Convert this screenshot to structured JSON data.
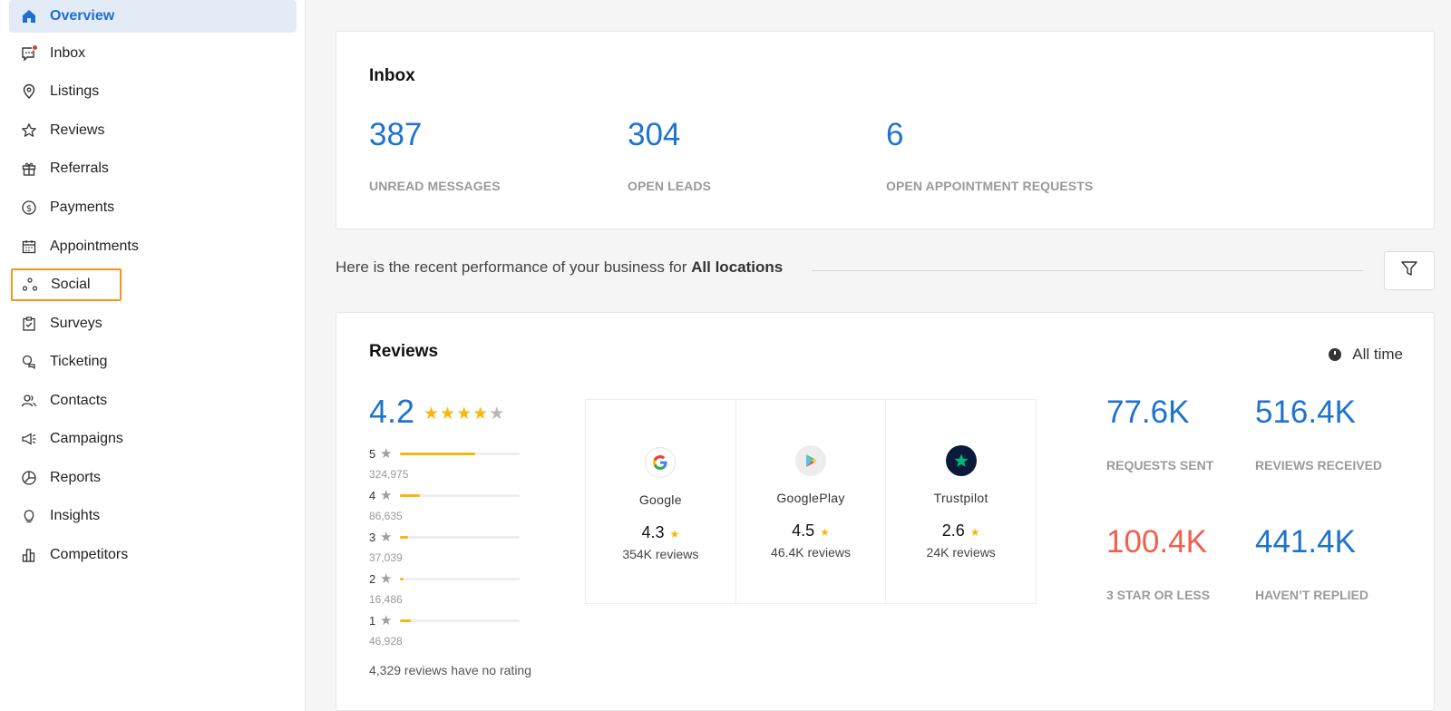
{
  "sidebar": {
    "items": [
      {
        "key": "overview",
        "label": "Overview",
        "icon": "home-icon"
      },
      {
        "key": "inbox",
        "label": "Inbox",
        "icon": "inbox-icon"
      },
      {
        "key": "listings",
        "label": "Listings",
        "icon": "location-pin-icon"
      },
      {
        "key": "reviews",
        "label": "Reviews",
        "icon": "star-icon"
      },
      {
        "key": "referrals",
        "label": "Referrals",
        "icon": "gift-icon"
      },
      {
        "key": "payments",
        "label": "Payments",
        "icon": "dollar-icon"
      },
      {
        "key": "appointments",
        "label": "Appointments",
        "icon": "calendar-icon"
      },
      {
        "key": "social",
        "label": "Social",
        "icon": "social-nodes-icon"
      },
      {
        "key": "surveys",
        "label": "Surveys",
        "icon": "survey-check-icon"
      },
      {
        "key": "ticketing",
        "label": "Ticketing",
        "icon": "chat-bubbles-icon"
      },
      {
        "key": "contacts",
        "label": "Contacts",
        "icon": "contacts-icon"
      },
      {
        "key": "campaigns",
        "label": "Campaigns",
        "icon": "megaphone-icon"
      },
      {
        "key": "reports",
        "label": "Reports",
        "icon": "pie-chart-icon"
      },
      {
        "key": "insights",
        "label": "Insights",
        "icon": "lightbulb-icon"
      },
      {
        "key": "competitors",
        "label": "Competitors",
        "icon": "bar-chart-icon"
      }
    ],
    "active": "Overview",
    "highlighted": "Social"
  },
  "inbox": {
    "title": "Inbox",
    "stats": [
      {
        "value": "387",
        "caption": "UNREAD MESSAGES"
      },
      {
        "value": "304",
        "caption": "OPEN LEADS"
      },
      {
        "value": "6",
        "caption": "OPEN APPOINTMENT REQUESTS"
      }
    ]
  },
  "performance": {
    "text": "Here is the recent performance of your business for",
    "location": "All locations",
    "filter_icon": "filter-icon"
  },
  "reviews": {
    "title": "Reviews",
    "period": "All time",
    "average": "4.2",
    "stars_filled": 4,
    "distribution": [
      {
        "stars": "5",
        "count": "324,975",
        "fraction": 0.63
      },
      {
        "stars": "4",
        "count": "86,635",
        "fraction": 0.17
      },
      {
        "stars": "3",
        "count": "37,039",
        "fraction": 0.07
      },
      {
        "stars": "2",
        "count": "16,486",
        "fraction": 0.03
      },
      {
        "stars": "1",
        "count": "46,928",
        "fraction": 0.09
      }
    ],
    "no_rating": "4,329 reviews have no rating",
    "sources": [
      {
        "name": "Google",
        "rating": "4.3",
        "count": "354K reviews",
        "icon": "google-logo-icon"
      },
      {
        "name": "GooglePlay",
        "rating": "4.5",
        "count": "46.4K reviews",
        "icon": "google-play-logo-icon"
      },
      {
        "name": "Trustpilot",
        "rating": "2.6",
        "count": "24K reviews",
        "icon": "trustpilot-logo-icon"
      }
    ],
    "kpis": [
      {
        "value": "77.6K",
        "caption": "REQUESTS SENT",
        "color": "#1e73cf"
      },
      {
        "value": "516.4K",
        "caption": "REVIEWS RECEIVED",
        "color": "#1e73cf"
      },
      {
        "value": "100.4K",
        "caption": "3 STAR OR LESS",
        "color": "#f0604d"
      },
      {
        "value": "441.4K",
        "caption": "HAVEN’T REPLIED",
        "color": "#1e73cf"
      }
    ]
  },
  "colors": {
    "accent": "#1e73cf",
    "highlight": "#f7931e",
    "star": "#f5b80f",
    "negative": "#f0604d"
  }
}
